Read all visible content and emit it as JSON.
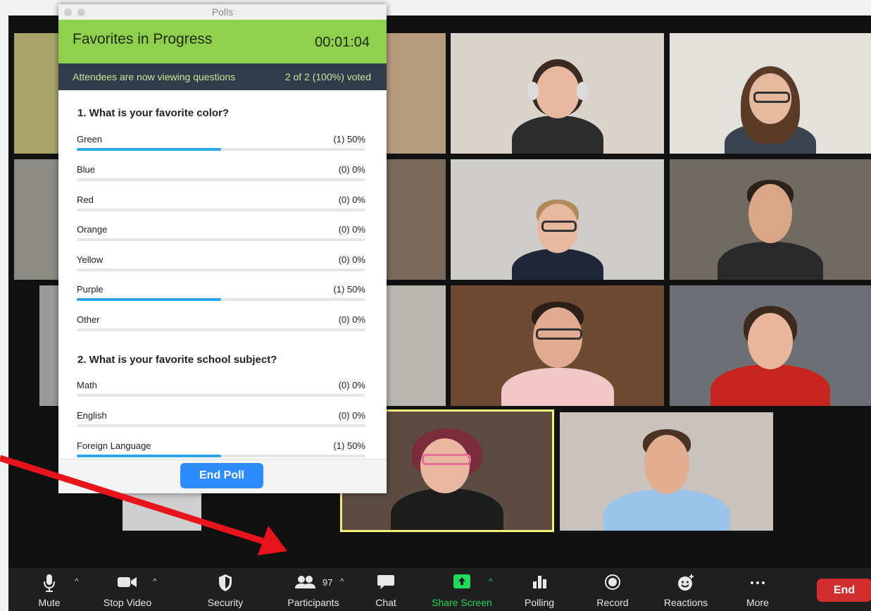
{
  "poll": {
    "window_title": "Polls",
    "name": "Favorites in Progress",
    "timer": "00:01:04",
    "status": "Attendees are now viewing questions",
    "votes": "2 of 2 (100%) voted",
    "questions": [
      {
        "text": "1. What is your favorite color?",
        "options": [
          {
            "label": "Green",
            "result": "(1) 50%",
            "fraction": 0.5
          },
          {
            "label": "Blue",
            "result": "(0) 0%",
            "fraction": 0
          },
          {
            "label": "Red",
            "result": "(0) 0%",
            "fraction": 0
          },
          {
            "label": "Orange",
            "result": "(0) 0%",
            "fraction": 0
          },
          {
            "label": "Yellow",
            "result": "(0) 0%",
            "fraction": 0
          },
          {
            "label": "Purple",
            "result": "(1) 50%",
            "fraction": 0.5
          },
          {
            "label": "Other",
            "result": "(0) 0%",
            "fraction": 0
          }
        ]
      },
      {
        "text": "2. What is your favorite school subject?",
        "options": [
          {
            "label": "Math",
            "result": "(0) 0%",
            "fraction": 0
          },
          {
            "label": "English",
            "result": "(0) 0%",
            "fraction": 0
          },
          {
            "label": "Foreign Language",
            "result": "(1) 50%",
            "fraction": 0.5
          }
        ]
      }
    ],
    "end_label": "End Poll"
  },
  "toolbar": {
    "mute": "Mute",
    "stop_video": "Stop Video",
    "security": "Security",
    "participants": "Participants",
    "participants_count": "97",
    "chat": "Chat",
    "share_screen": "Share Screen",
    "polling": "Polling",
    "record": "Record",
    "reactions": "Reactions",
    "more": "More",
    "end": "End"
  },
  "colors": {
    "poll_header": "#8fd14f",
    "poll_status_bg": "#2f3d4a",
    "vote_bar": "#2da7e6",
    "end_poll_button": "#2d8cff",
    "share_screen": "#23d959",
    "end_button": "#d12f2f",
    "annotation_arrow": "#e8141b",
    "active_speaker_border": "#f2f07a"
  },
  "icons": {
    "mute": "microphone-icon",
    "stop_video": "video-camera-icon",
    "security": "shield-icon",
    "participants": "people-icon",
    "chat": "speech-bubble-icon",
    "share_screen": "share-arrow-icon",
    "polling": "bar-chart-icon",
    "record": "record-circle-icon",
    "reactions": "smiley-plus-icon",
    "more": "ellipsis-icon"
  }
}
